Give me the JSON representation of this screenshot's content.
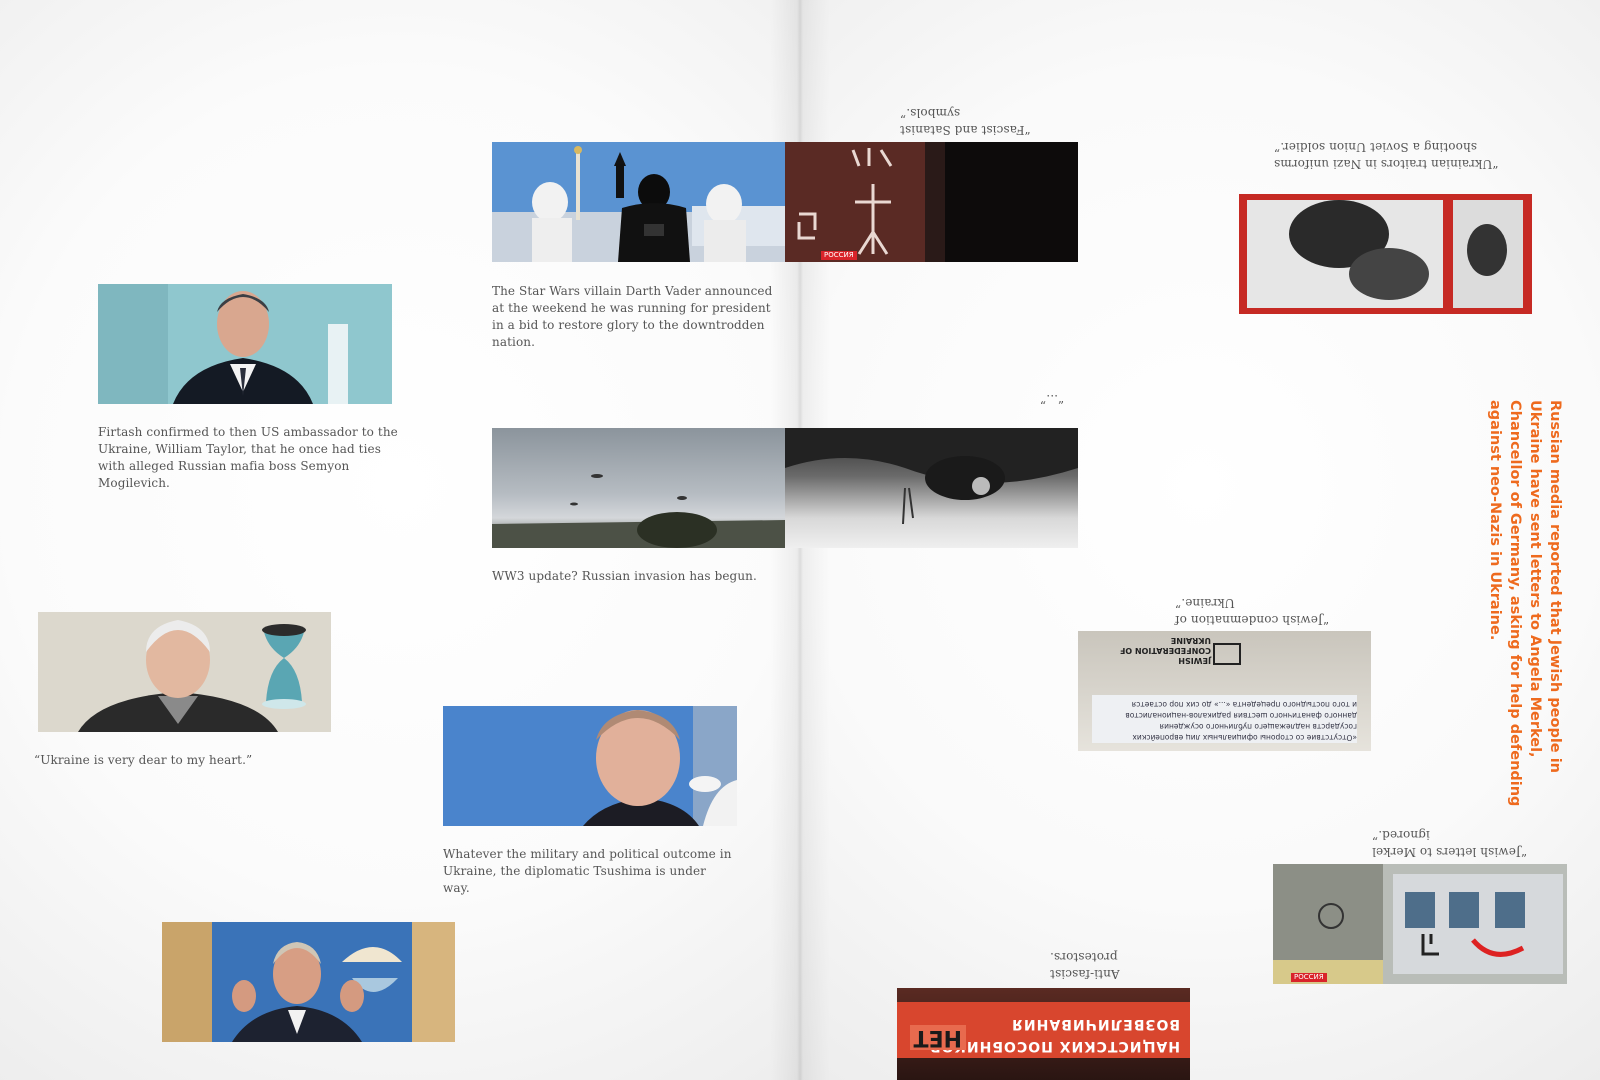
{
  "captions": {
    "firtash": "Firtash confirmed to then US ambassador to the Ukraine, William Taylor, that he once had ties with alleged Russian mafia boss Semyon Mogilevich.",
    "vader": "The Star Wars villain Darth Vader announced at the weekend he was running for president in a bid to restore glory to the downtrodden nation.",
    "ww3": "WW3 update? Russian invasion has begun.",
    "assange": "“Ukraine is very dear to my heart.”",
    "putin": "Whatever the military and political outcome in Ukraine, the diplomatic Tsushima is under way.",
    "fascist": "“Fascist and Satanist symbols.”",
    "traitors": "“Ukrainian traitors in Nazi uniforms shooting a Soviet Union soldier.”",
    "ellipsis": "“...”",
    "jewish_condemnation": "“Jewish condemnation of Ukraine.”",
    "merkel_ignored": "“Jewish letters to Merkel ignored.”",
    "antifascist": "Anti-fascist protestors."
  },
  "callout": "Russian media reported that Jewish people in Ukraine have sent letters to Angela Merkel, Chancellor of Germany, asking for help defending against neo-Nazis in Ukraine.",
  "overlays": {
    "channel_badge": "РОССИЯ",
    "banner_top": "НАЦИСТСКИХ ПОСОБНИКОВ",
    "banner_bottom": "ВОЗВЕЛИЧИВАНИЯ",
    "banner_net": "НЕТ",
    "doc_org": "JEWISH CONFEDERATION OF UKRAINE",
    "doc_line1": "«Отсутствие со стороны официальных лиц европейских",
    "doc_line2": "государств надлежащего публичного осуждения",
    "doc_line3": "данного фанатичного шествия радикалов-националистов",
    "doc_line4": "и того постыдного прецедента «...» до сих пор остается"
  },
  "colors": {
    "accent_orange": "#ee6a1e",
    "caption_gray": "#555555"
  }
}
